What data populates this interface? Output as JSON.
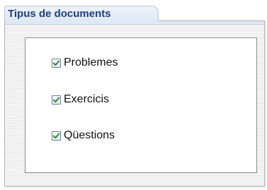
{
  "tab": {
    "label": "Tipus de documents"
  },
  "options": [
    {
      "label": "Problemes",
      "checked": true
    },
    {
      "label": "Exercicis",
      "checked": true
    },
    {
      "label": "Qüestions",
      "checked": true
    }
  ],
  "colors": {
    "tab_text": "#1d3f7a",
    "check_mark": "#2e8b2e"
  },
  "icons": {
    "check": "checkmark-icon"
  }
}
